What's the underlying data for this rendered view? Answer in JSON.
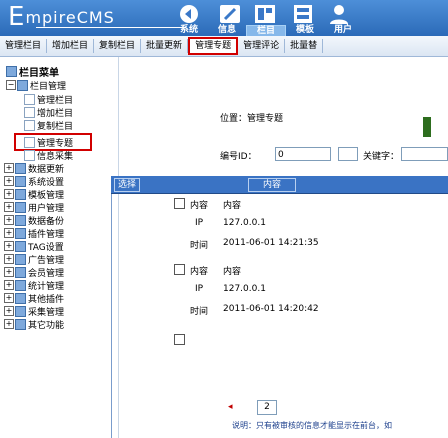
{
  "app": {
    "logo_letter": "E",
    "logo_text": "mpireCMS"
  },
  "top_nav": [
    "系统",
    "信息",
    "栏目",
    "模板",
    "用户"
  ],
  "top_nav_active_index": 2,
  "subtabs": [
    "管理栏目",
    "增加栏目",
    "复制栏目",
    "批量更新",
    "管理专题",
    "管理评论",
    "批量替"
  ],
  "subtabs_active_index": 4,
  "tree": {
    "root": "栏目菜单",
    "groups": [
      {
        "label": "栏目管理"
      },
      {
        "label": "管理栏目"
      },
      {
        "label": "增加栏目"
      },
      {
        "label": "复制栏目"
      },
      {
        "label": "管理专题"
      },
      {
        "label": "信息采集"
      },
      {
        "label": "数据更新"
      },
      {
        "label": "系统设置"
      },
      {
        "label": "模板管理"
      },
      {
        "label": "用户管理"
      },
      {
        "label": "数据备份"
      },
      {
        "label": "插件管理"
      },
      {
        "label": "TAG设置"
      },
      {
        "label": "广告管理"
      },
      {
        "label": "会员管理"
      },
      {
        "label": "统计管理"
      },
      {
        "label": "其他插件"
      },
      {
        "label": "采集管理"
      },
      {
        "label": "其它功能"
      }
    ]
  },
  "main": {
    "position_label": "位置：管理专题",
    "search_label": "编号ID：",
    "search_value": "0",
    "keyword_label": "关键字：",
    "keyword_value": "",
    "list_headers": [
      "选择",
      "内容"
    ],
    "entries": [
      {
        "k1": "内容",
        "v1": "内容",
        "ip_label": "IP",
        "ip": "127.0.0.1",
        "time_label": "时间",
        "time": "2011-06-01 14:21:35"
      },
      {
        "k1": "内容",
        "v1": "内容",
        "ip_label": "IP",
        "ip": "127.0.0.1",
        "time_label": "时间",
        "time": "2011-06-01 14:20:42"
      }
    ],
    "page": "2",
    "footer": "说明：只有被审核的信息才能显示在前台，如"
  }
}
